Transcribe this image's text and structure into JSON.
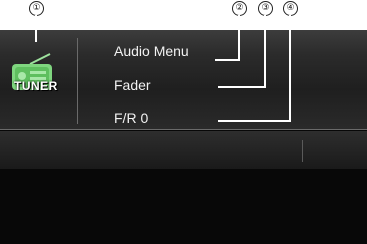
{
  "callouts": [
    "①",
    "②",
    "③",
    "④"
  ],
  "source": {
    "icon": "radio-icon",
    "label": "TUNER"
  },
  "menu": [
    {
      "label": "Audio Menu"
    },
    {
      "label": "Fader"
    },
    {
      "label": "F/R 0"
    }
  ],
  "colors": {
    "icon_green": "#7fd67f",
    "text": "#f2f2f2",
    "screen_bg": "#080808"
  }
}
